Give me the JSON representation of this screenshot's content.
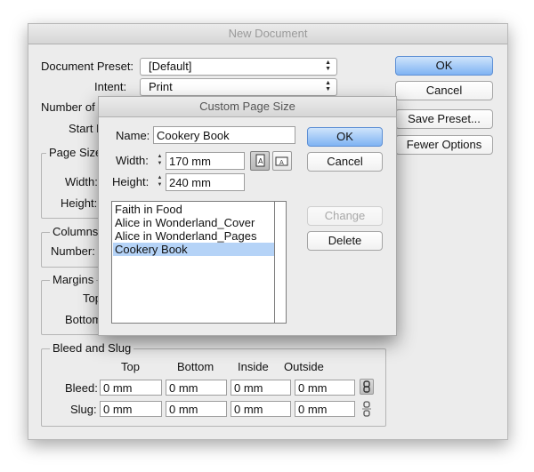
{
  "window": {
    "title": "New Document"
  },
  "main": {
    "document_preset_label": "Document Preset:",
    "document_preset_value": "[Default]",
    "intent_label": "Intent:",
    "intent_value": "Print",
    "number_of_label": "Number of",
    "start_label": "Start P",
    "page_size_label": "Page Size",
    "width_label": "Width:",
    "height_label": "Height:",
    "columns_label": "Columns",
    "number_label": "Number:",
    "margins_label": "Margins",
    "top_label": "Top",
    "bottom_label": "Bottom"
  },
  "buttons": {
    "ok": "OK",
    "cancel": "Cancel",
    "save_preset": "Save Preset...",
    "fewer_options": "Fewer Options"
  },
  "bleed_slug": {
    "title": "Bleed and Slug",
    "columns": [
      "Top",
      "Bottom",
      "Inside",
      "Outside"
    ],
    "bleed_label": "Bleed:",
    "slug_label": "Slug:",
    "bleed_values": [
      "0 mm",
      "0 mm",
      "0 mm",
      "0 mm"
    ],
    "slug_values": [
      "0 mm",
      "0 mm",
      "0 mm",
      "0 mm"
    ]
  },
  "custom_page_size": {
    "title": "Custom Page Size",
    "name_label": "Name:",
    "name_value": "Cookery Book",
    "width_label": "Width:",
    "width_value": "170 mm",
    "height_label": "Height:",
    "height_value": "240 mm",
    "ok": "OK",
    "cancel": "Cancel",
    "change": "Change",
    "delete": "Delete",
    "items": [
      "Faith in Food",
      "Alice in Wonderland_Cover",
      "Alice in Wonderland_Pages",
      "Cookery Book"
    ],
    "selected_item": "Cookery Book"
  },
  "colors": {
    "accent": "#7fb3f3",
    "selection": "#b5d3f7",
    "window_bg": "#ececec"
  }
}
